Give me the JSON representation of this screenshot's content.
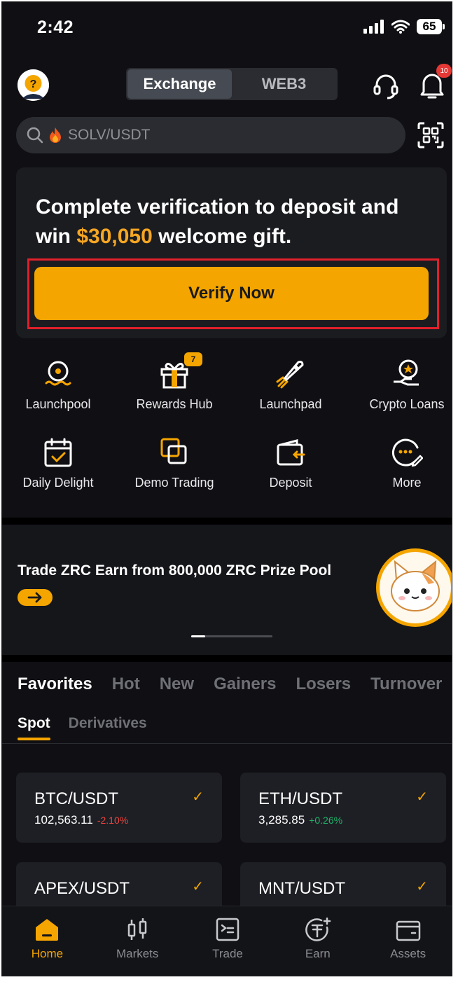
{
  "status_bar": {
    "time": "2:42",
    "battery": "65"
  },
  "header": {
    "tabs": [
      {
        "label": "Exchange",
        "active": true
      },
      {
        "label": "WEB3",
        "active": false
      }
    ],
    "notification_count": "10"
  },
  "search": {
    "placeholder": "SOLV/USDT"
  },
  "promo": {
    "title_before": "Complete verification to deposit and win ",
    "title_amount": "$30,050",
    "title_after": " welcome gift.",
    "button_label": "Verify Now"
  },
  "shortcuts": [
    {
      "label": "Launchpool",
      "icon": "launchpool-icon"
    },
    {
      "label": "Rewards Hub",
      "icon": "gift-icon",
      "badge": "7"
    },
    {
      "label": "Launchpad",
      "icon": "rocket-icon"
    },
    {
      "label": "Crypto Loans",
      "icon": "loan-icon"
    },
    {
      "label": "Daily Delight",
      "icon": "calendar-icon"
    },
    {
      "label": "Demo Trading",
      "icon": "demo-trading-icon"
    },
    {
      "label": "Deposit",
      "icon": "wallet-deposit-icon"
    },
    {
      "label": "More",
      "icon": "more-icon"
    }
  ],
  "banner": {
    "title": "Trade ZRC Earn from 800,000 ZRC Prize Pool"
  },
  "market_tabs": [
    "Favorites",
    "Hot",
    "New",
    "Gainers",
    "Losers",
    "Turnover"
  ],
  "sub_tabs": [
    "Spot",
    "Derivatives"
  ],
  "coins": [
    {
      "pair": "BTC/USDT",
      "price": "102,563.11",
      "change": "-2.10%"
    },
    {
      "pair": "ETH/USDT",
      "price": "3,285.85",
      "change": "+0.26%"
    },
    {
      "pair": "APEX/USDT",
      "price": "",
      "change": ""
    },
    {
      "pair": "MNT/USDT",
      "price": "",
      "change": ""
    }
  ],
  "bottom_nav": [
    {
      "label": "Home",
      "active": true
    },
    {
      "label": "Markets",
      "active": false
    },
    {
      "label": "Trade",
      "active": false
    },
    {
      "label": "Earn",
      "active": false
    },
    {
      "label": "Assets",
      "active": false
    }
  ],
  "colors": {
    "accent": "#f5a500",
    "negative": "#f0443f",
    "positive": "#21b36b",
    "background": "#101014"
  }
}
